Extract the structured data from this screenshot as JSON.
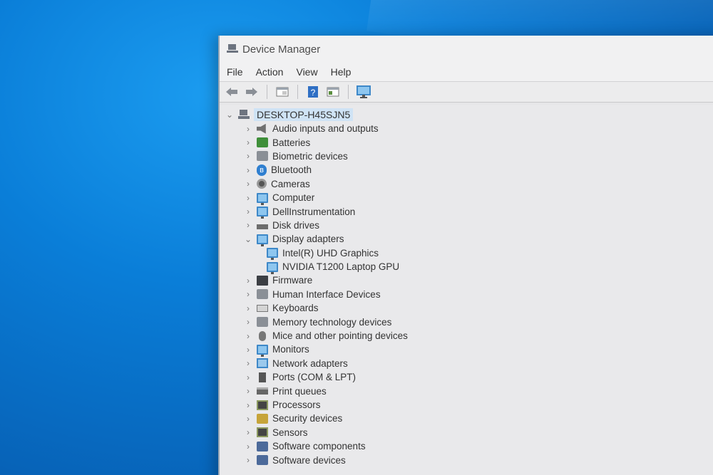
{
  "window": {
    "title": "Device Manager"
  },
  "menu": [
    "File",
    "Action",
    "View",
    "Help"
  ],
  "toolbar": {
    "icons": [
      "back-icon",
      "forward-icon",
      "properties-icon",
      "help-icon",
      "show-hide-console-icon",
      "monitor-scan-icon"
    ]
  },
  "tree": {
    "root": "DESKTOP-H45SJN5",
    "categories": [
      {
        "label": "Audio inputs and outputs",
        "icon": "speaker-icon",
        "expanded": false
      },
      {
        "label": "Batteries",
        "icon": "battery-icon",
        "expanded": false
      },
      {
        "label": "Biometric devices",
        "icon": "fingerprint-icon",
        "expanded": false
      },
      {
        "label": "Bluetooth",
        "icon": "bluetooth-icon",
        "expanded": false
      },
      {
        "label": "Cameras",
        "icon": "camera-icon",
        "expanded": false
      },
      {
        "label": "Computer",
        "icon": "computer-icon",
        "expanded": false
      },
      {
        "label": "DellInstrumentation",
        "icon": "monitor-icon",
        "expanded": false
      },
      {
        "label": "Disk drives",
        "icon": "disk-icon",
        "expanded": false
      },
      {
        "label": "Display adapters",
        "icon": "display-adapter-icon",
        "expanded": true,
        "children": [
          "Intel(R) UHD Graphics",
          "NVIDIA T1200 Laptop GPU"
        ]
      },
      {
        "label": "Firmware",
        "icon": "firmware-icon",
        "expanded": false
      },
      {
        "label": "Human Interface Devices",
        "icon": "hid-icon",
        "expanded": false
      },
      {
        "label": "Keyboards",
        "icon": "keyboard-icon",
        "expanded": false
      },
      {
        "label": "Memory technology devices",
        "icon": "memory-icon",
        "expanded": false
      },
      {
        "label": "Mice and other pointing devices",
        "icon": "mouse-icon",
        "expanded": false
      },
      {
        "label": "Monitors",
        "icon": "monitor-icon",
        "expanded": false
      },
      {
        "label": "Network adapters",
        "icon": "network-icon",
        "expanded": false
      },
      {
        "label": "Ports (COM & LPT)",
        "icon": "port-icon",
        "expanded": false
      },
      {
        "label": "Print queues",
        "icon": "printer-icon",
        "expanded": false
      },
      {
        "label": "Processors",
        "icon": "processor-icon",
        "expanded": false
      },
      {
        "label": "Security devices",
        "icon": "security-icon",
        "expanded": false
      },
      {
        "label": "Sensors",
        "icon": "sensor-icon",
        "expanded": false
      },
      {
        "label": "Software components",
        "icon": "software-component-icon",
        "expanded": false
      },
      {
        "label": "Software devices",
        "icon": "software-device-icon",
        "expanded": false
      }
    ]
  },
  "colors": {
    "desktop": "#0a7ed8",
    "window_bg": "#e9e9eb",
    "selection": "#cfe3f5",
    "accent": "#3e88c8"
  }
}
